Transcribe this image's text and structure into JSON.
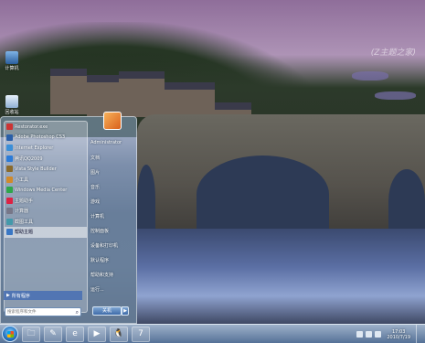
{
  "desktop": {
    "watermark": "(Z主题之家)",
    "icons": [
      {
        "label": "计算机"
      },
      {
        "label": "回收站"
      }
    ]
  },
  "start_menu": {
    "programs": [
      {
        "label": "Restorator.exe",
        "color": "#c33"
      },
      {
        "label": "Adobe Photoshop CS3",
        "color": "#2a5fa8"
      },
      {
        "label": "Internet Explorer",
        "color": "#3b8fd8"
      },
      {
        "label": "腾讯QQ2009",
        "color": "#2b7bd8"
      },
      {
        "label": "Vista Style Builder",
        "color": "#8a6a2b"
      },
      {
        "label": "小工具",
        "color": "#d08a2b"
      },
      {
        "label": "Windows Media Center",
        "color": "#2fa64a"
      },
      {
        "label": "主题助手",
        "color": "#d24"
      },
      {
        "label": "计算器",
        "color": "#778"
      },
      {
        "label": "截图工具",
        "color": "#49a"
      },
      {
        "label": "帮助主题",
        "color": "#3a77c4",
        "selected": true
      }
    ],
    "all_programs_label": "所有程序",
    "search_placeholder": "搜索程序和文件",
    "right_items": [
      {
        "label": "Administrator"
      },
      {
        "label": "文档"
      },
      {
        "label": "图片"
      },
      {
        "label": "音乐"
      },
      {
        "label": "游戏"
      },
      {
        "label": "计算机"
      },
      {
        "label": "控制面板"
      },
      {
        "label": "设备和打印机"
      },
      {
        "label": "默认程序"
      },
      {
        "label": "帮助和支持"
      },
      {
        "label": "运行..."
      }
    ],
    "shutdown_label": "关机",
    "shutdown_arrow": "▶"
  },
  "taskbar": {
    "pinned": [
      {
        "name": "explorer-icon",
        "glyph": "🗀"
      },
      {
        "name": "pen-icon",
        "glyph": "✎"
      },
      {
        "name": "ie-icon",
        "glyph": "e"
      },
      {
        "name": "player-icon",
        "glyph": "▶"
      },
      {
        "name": "qq-icon",
        "glyph": "🐧"
      },
      {
        "name": "windows7-icon",
        "glyph": "7"
      }
    ],
    "clock_time": "17:03",
    "clock_date": "2010/7/19"
  },
  "colors": {
    "accent": "#3e6aa8",
    "user_picture": "#e8842c"
  }
}
